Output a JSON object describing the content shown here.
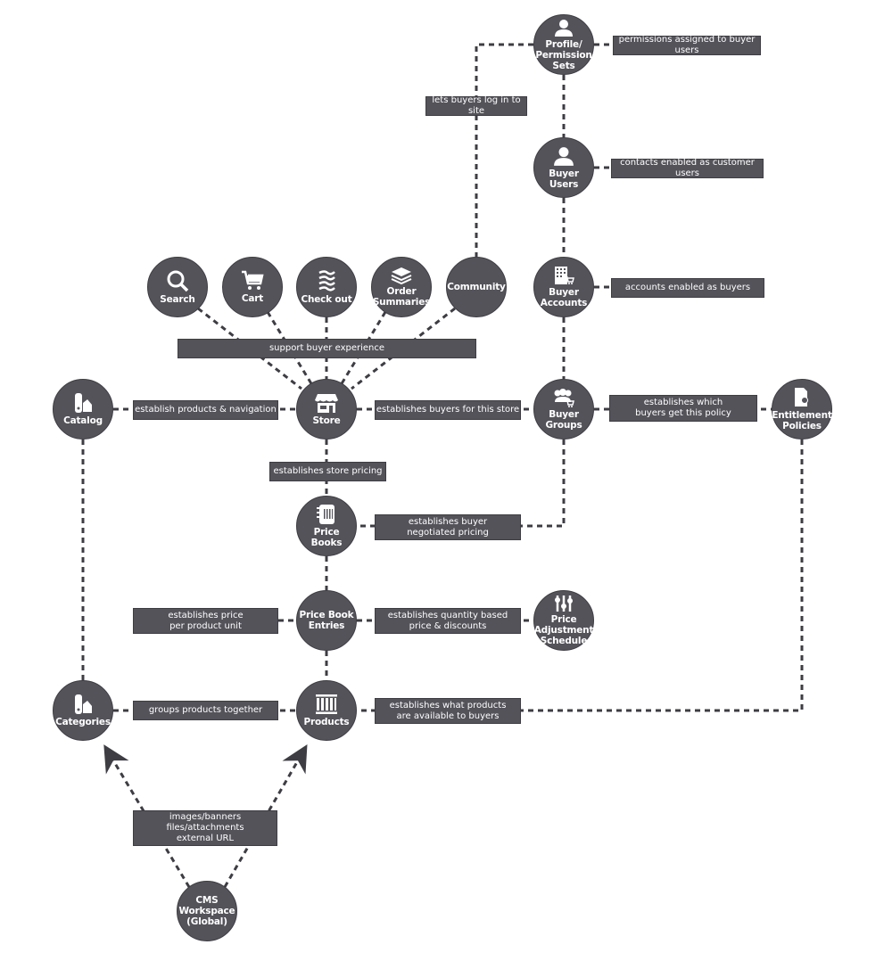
{
  "diagram": {
    "nodes": {
      "profile": {
        "label": "Profile/\nPermission\nSets",
        "icon": "user-icon"
      },
      "buyer_users": {
        "label": "Buyer\nUsers",
        "icon": "user-icon"
      },
      "buyer_accounts": {
        "label": "Buyer\nAccounts",
        "icon": "building-cart-icon"
      },
      "buyer_groups": {
        "label": "Buyer\nGroups",
        "icon": "group-cart-icon"
      },
      "entitlement": {
        "label": "Entitlement\nPolicies",
        "icon": "document-ribbon-icon"
      },
      "search": {
        "label": "Search",
        "icon": "search-icon"
      },
      "cart": {
        "label": "Cart",
        "icon": "cart-icon"
      },
      "checkout": {
        "label": "Check out",
        "icon": "checkout-icon"
      },
      "order_summaries": {
        "label": "Order\nSummaries",
        "icon": "layers-icon"
      },
      "community": {
        "label": "Community",
        "icon": ""
      },
      "catalog": {
        "label": "Catalog",
        "icon": "swatch-icon"
      },
      "store": {
        "label": "Store",
        "icon": "storefront-icon"
      },
      "price_books": {
        "label": "Price\nBooks",
        "icon": "pricebook-icon"
      },
      "price_book_entries": {
        "label": "Price Book\nEntries",
        "icon": ""
      },
      "price_adjustment": {
        "label": "Price\nAdjustment\nSchedule",
        "icon": "sliders-icon"
      },
      "categories": {
        "label": "Categories",
        "icon": "swatch-icon"
      },
      "products": {
        "label": "Products",
        "icon": "products-icon"
      },
      "cms": {
        "label": "CMS\nWorkspace\n(Global)",
        "icon": ""
      }
    },
    "labels": {
      "permissions": "permissions assigned to buyer users",
      "login": "lets buyers log in to site",
      "contacts": "contacts enabled as customer users",
      "accounts": "accounts enabled as buyers",
      "support": "support buyer experience",
      "establish_products": "establish products & navigation",
      "buyers_store": "establishes buyers for this store",
      "which_buyers": "establishes which\nbuyers get this policy",
      "store_pricing": "establishes store pricing",
      "negotiated": "establishes buyer\nnegotiated pricing",
      "price_per_unit": "establishes price\nper product unit",
      "quantity_based": "establishes quantity based\nprice & discounts",
      "groups_products": "groups products together",
      "available_products": "establishes what products\nare available to buyers",
      "cms_content": "images/banners\nfiles/attachments\nexternal URL"
    },
    "colors": {
      "node": "#54535a",
      "line": "#3e3d43",
      "text": "#ffffff"
    }
  }
}
